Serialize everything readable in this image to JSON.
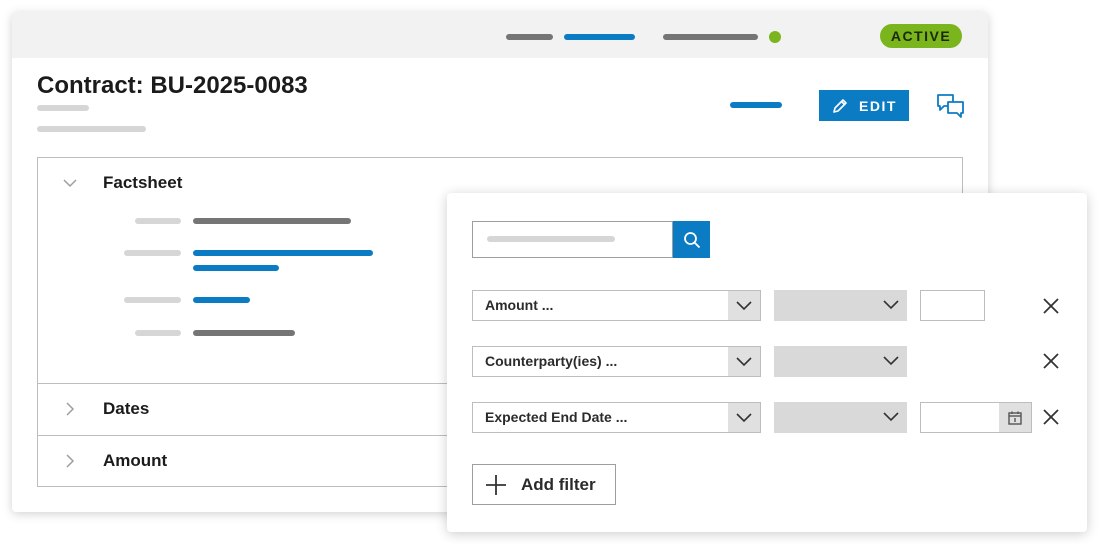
{
  "status": {
    "label": "ACTIVE",
    "color": "#7ab51d"
  },
  "contract": {
    "title": "Contract: BU-2025-0083"
  },
  "toolbar": {
    "edit_label": "EDIT",
    "edit_icon": "pencil-icon",
    "comments_icon": "chat-bubbles-icon"
  },
  "accordion": {
    "sections": [
      {
        "label": "Factsheet",
        "expanded": true
      },
      {
        "label": "Dates",
        "expanded": false
      },
      {
        "label": "Amount",
        "expanded": false
      }
    ]
  },
  "filter_panel": {
    "search": {
      "value": "",
      "icon": "search-icon"
    },
    "filters": [
      {
        "field": "Amount ...",
        "operator": "",
        "value": "",
        "has_value_input": true,
        "has_calendar": false
      },
      {
        "field": "Counterparty(ies) ...",
        "operator": "",
        "value": "",
        "has_value_input": false,
        "has_calendar": false
      },
      {
        "field": "Expected End Date ...",
        "operator": "",
        "value": "",
        "has_value_input": true,
        "has_calendar": true
      }
    ],
    "add_filter_label": "Add filter"
  },
  "colors": {
    "accent": "#0b7cc4",
    "status_green": "#7ab51d",
    "placeholder_grey": "#d6d6d6",
    "text_grey": "#757575"
  }
}
